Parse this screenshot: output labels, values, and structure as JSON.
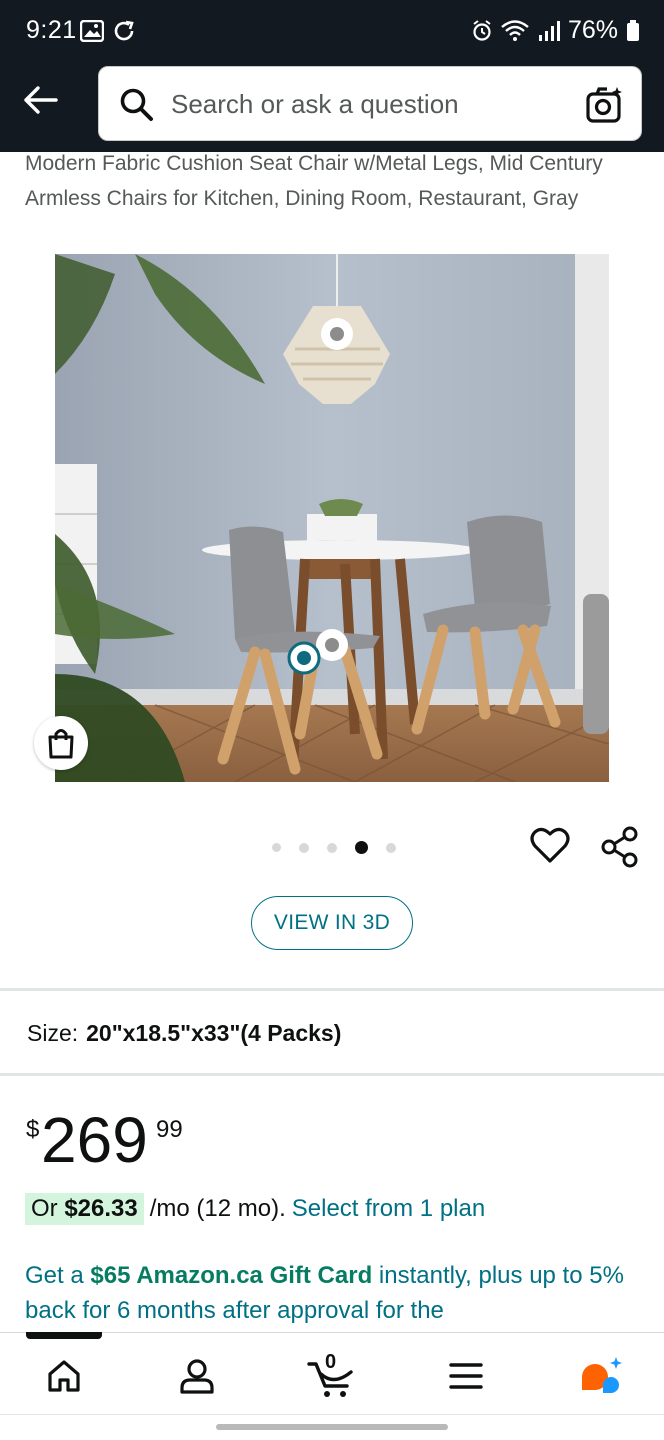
{
  "status_bar": {
    "time": "9:21",
    "battery": "76%",
    "icons": [
      "gallery-icon",
      "sync-icon",
      "alarm-icon",
      "wifi-icon",
      "signal-icon",
      "battery-icon"
    ]
  },
  "header": {
    "search_placeholder": "Search or ask a question",
    "icons": [
      "back-arrow-icon",
      "search-icon",
      "camera-search-icon"
    ]
  },
  "product": {
    "title": "Modern Fabric Cushion Seat Chair w/Metal Legs, Mid Century Armless Chairs for Kitchen, Dining Room, Restaurant, Gray",
    "image_count": 5,
    "active_image_index": 3,
    "view_3d_label": "VIEW IN 3D"
  },
  "size": {
    "label": "Size:",
    "value": "20\"x18.5\"x33\"(4 Packs)"
  },
  "price": {
    "symbol": "$",
    "whole": "269",
    "fraction": "99"
  },
  "financing": {
    "prefix": "Or ",
    "monthly_amount": "$26.33",
    "rest": "/mo (12 mo).",
    "link": "Select from 1 plan"
  },
  "promo": {
    "before": "Get a ",
    "highlight": "$65 Amazon.ca Gift Card",
    "after": " instantly, plus up to 5% back for 6 months after approval for the"
  },
  "bottom_nav": {
    "cart_count": "0",
    "items": [
      "home-icon",
      "account-icon",
      "cart-icon",
      "menu-icon",
      "rufus-ai-icon"
    ]
  },
  "colors": {
    "header_bg": "#131921",
    "link": "#007185",
    "promo_green": "#067d62",
    "financing_highlight": "#d3f5dd",
    "ai_orange": "#ff6200",
    "ai_blue": "#1a98ff"
  }
}
